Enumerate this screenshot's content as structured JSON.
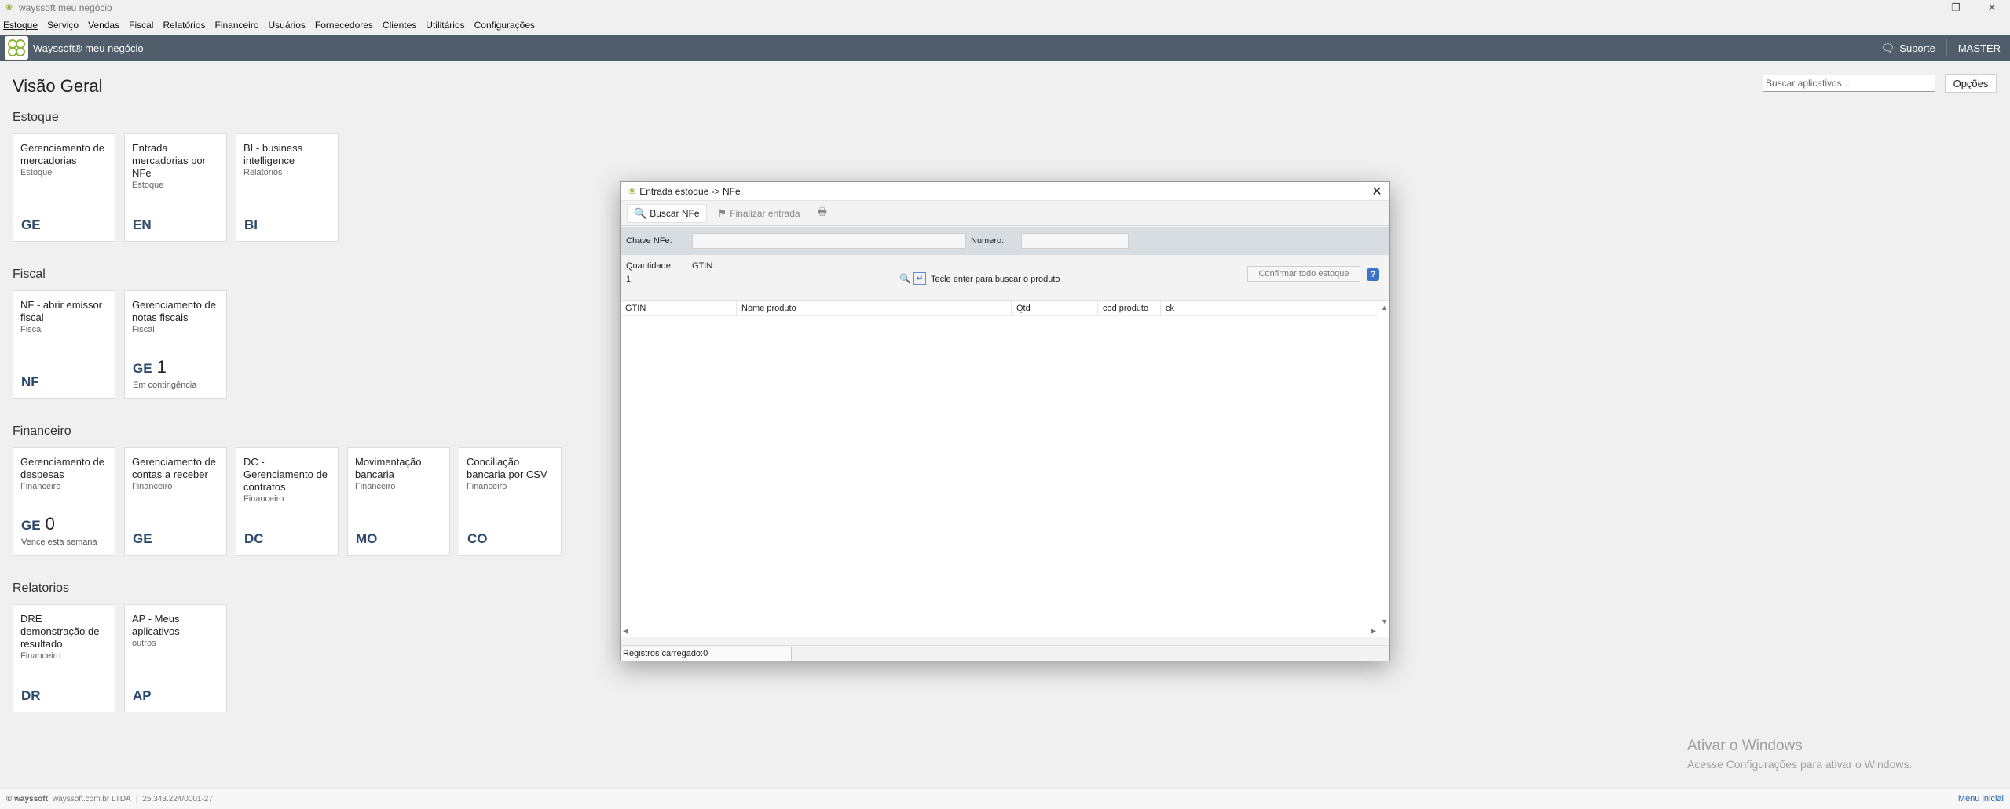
{
  "window": {
    "title": "wayssoft meu negócio",
    "controls": [
      "—",
      "❐",
      "✕"
    ]
  },
  "menu": [
    "Estoque",
    "Serviço",
    "Vendas",
    "Fiscal",
    "Relatórios",
    "Financeiro",
    "Usuários",
    "Fornecedores",
    "Clientes",
    "Utilitários",
    "Configurações"
  ],
  "header": {
    "app_name": "Wayssoft® meu negócio",
    "support": "Suporte",
    "user": "MASTER"
  },
  "page": {
    "title": "Visão Geral",
    "search_placeholder": "Buscar aplicativos...",
    "options": "Opções"
  },
  "sections": [
    {
      "title": "Estoque",
      "tiles": [
        {
          "name": "Gerenciamento de mercadorias",
          "category": "Estoque",
          "abbr": "GE"
        },
        {
          "name": "Entrada mercadorias por NFe",
          "category": "Estoque",
          "abbr": "EN"
        },
        {
          "name": "BI - business intelligence",
          "category": "Relatorios",
          "abbr": "BI"
        }
      ]
    },
    {
      "title": "Fiscal",
      "tiles": [
        {
          "name": "NF - abrir emissor fiscal",
          "category": "Fiscal",
          "abbr": "NF"
        },
        {
          "name": "Gerenciamento de notas fiscais",
          "category": "Fiscal",
          "abbr": "GE",
          "count": "1",
          "count_label": "Em contingência"
        }
      ]
    },
    {
      "title": "Financeiro",
      "tiles": [
        {
          "name": "Gerenciamento de despesas",
          "category": "Financeiro",
          "abbr": "GE",
          "count": "0",
          "count_label": "Vence esta semana"
        },
        {
          "name": "Gerenciamento de contas a receber",
          "category": "Financeiro",
          "abbr": "GE"
        },
        {
          "name": "DC - Gerenciamento de contratos",
          "category": "Financeiro",
          "abbr": "DC"
        },
        {
          "name": "Movimentação bancaria",
          "category": "Financeiro",
          "abbr": "MO"
        },
        {
          "name": "Conciliação bancaria por CSV",
          "category": "Financeiro",
          "abbr": "CO"
        }
      ]
    },
    {
      "title": "Relatorios",
      "tiles": [
        {
          "name": "DRE demonstração de resultado",
          "category": "Financeiro",
          "abbr": "DR"
        },
        {
          "name": "AP - Meus aplicativos",
          "category": "outros",
          "abbr": "AP"
        }
      ]
    }
  ],
  "dialog": {
    "title": "Entrada estoque -> NFe",
    "toolbar": {
      "search": "Buscar NFe",
      "finalize": "Finalizar entrada"
    },
    "labels": {
      "chave": "Chave NFe:",
      "numero": "Numero:",
      "quantidade": "Quantidade:",
      "gtin": "GTIN:"
    },
    "quantity_value": "1",
    "enter_hint": "Tecle enter para buscar o produto",
    "confirm_all": "Confirmar todo estoque",
    "help": "?",
    "columns": [
      "GTIN",
      "Nome produto",
      "Qtd",
      "cod produto",
      "ck"
    ],
    "status": "Registros carregado:0"
  },
  "watermark": {
    "line1": "Ativar o Windows",
    "line2": "Acesse Configurações para ativar o Windows."
  },
  "footer": {
    "brand": "© wayssoft",
    "company": "wayssoft.com.br LTDA",
    "cnpj": "25.343.224/0001-27",
    "menu_inicial": "Menu inicial"
  },
  "colors": {
    "header_bg": "#4f5e6a",
    "tile_abbr": "#2b4a6b",
    "link": "#2563b0",
    "brand_green": "#8bb53a"
  }
}
